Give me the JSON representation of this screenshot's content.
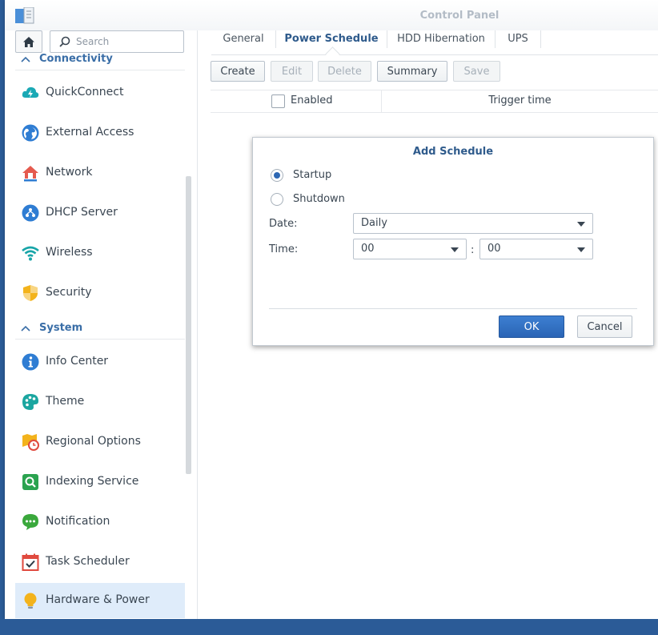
{
  "window": {
    "title": "Control Panel"
  },
  "sidebar": {
    "search_placeholder": "Search",
    "sections": [
      {
        "label": "Connectivity",
        "items": [
          {
            "label": "QuickConnect",
            "icon": "quickconnect-icon"
          },
          {
            "label": "External Access",
            "icon": "globe-icon"
          },
          {
            "label": "Network",
            "icon": "network-home-icon"
          },
          {
            "label": "DHCP Server",
            "icon": "dhcp-icon"
          },
          {
            "label": "Wireless",
            "icon": "wifi-icon"
          },
          {
            "label": "Security",
            "icon": "shield-icon"
          }
        ]
      },
      {
        "label": "System",
        "items": [
          {
            "label": "Info Center",
            "icon": "info-icon"
          },
          {
            "label": "Theme",
            "icon": "palette-icon"
          },
          {
            "label": "Regional Options",
            "icon": "regional-clock-icon"
          },
          {
            "label": "Indexing Service",
            "icon": "indexing-search-icon"
          },
          {
            "label": "Notification",
            "icon": "chat-bubble-icon"
          },
          {
            "label": "Task Scheduler",
            "icon": "calendar-check-icon"
          },
          {
            "label": "Hardware & Power",
            "icon": "lightbulb-icon",
            "active": true
          }
        ]
      }
    ]
  },
  "tabs": [
    {
      "label": "General"
    },
    {
      "label": "Power Schedule",
      "active": true
    },
    {
      "label": "HDD Hibernation"
    },
    {
      "label": "UPS"
    }
  ],
  "toolbar": {
    "create": "Create",
    "edit": "Edit",
    "delete": "Delete",
    "summary": "Summary",
    "save": "Save"
  },
  "grid": {
    "col_enabled": "Enabled",
    "col_trigger": "Trigger time"
  },
  "dialog": {
    "title": "Add Schedule",
    "radio_startup": "Startup",
    "radio_shutdown": "Shutdown",
    "selected": "Startup",
    "date_label": "Date:",
    "date_value": "Daily",
    "time_label": "Time:",
    "hour_value": "00",
    "minute_value": "00",
    "separator": ":",
    "ok": "OK",
    "cancel": "Cancel"
  },
  "colors": {
    "accent": "#2d67b3",
    "desktop": "#2b5b97",
    "active_nav": "#dfecfa"
  }
}
